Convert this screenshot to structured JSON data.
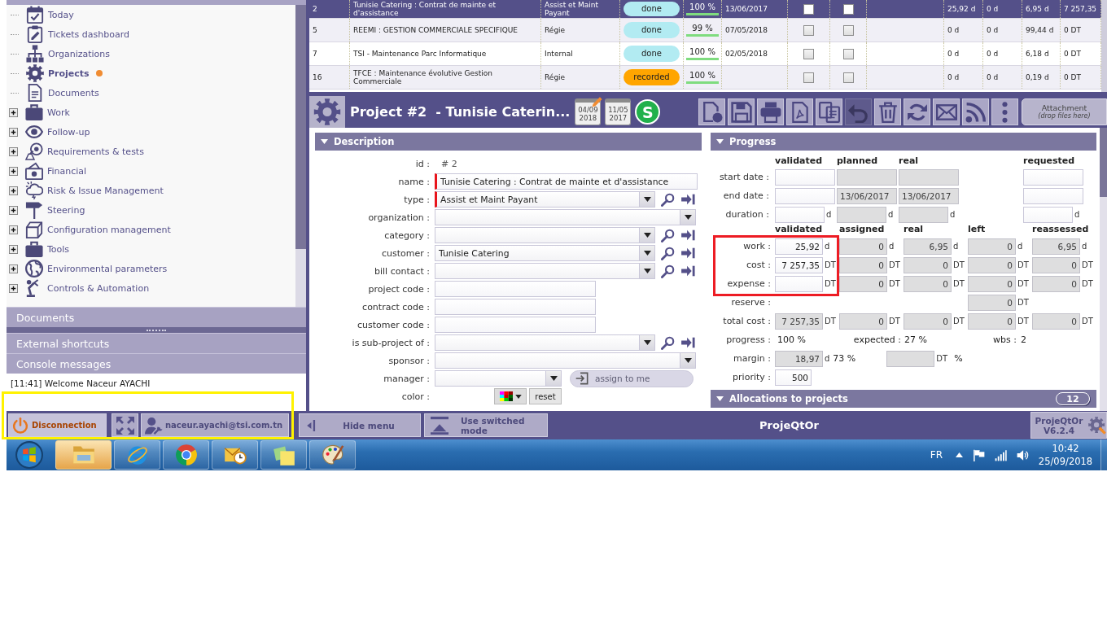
{
  "sidebar": {
    "menu": [
      {
        "label": "Today",
        "kind": "leaf",
        "selected": false
      },
      {
        "label": "Tickets dashboard",
        "kind": "leaf",
        "selected": false
      },
      {
        "label": "Organizations",
        "kind": "leaf",
        "selected": false
      },
      {
        "label": "Projects",
        "kind": "leaf",
        "selected": true
      },
      {
        "label": "Documents",
        "kind": "leaf",
        "selected": false
      },
      {
        "label": "Work",
        "kind": "group",
        "expanded": false,
        "selected": false
      },
      {
        "label": "Follow-up",
        "kind": "group",
        "expanded": false,
        "selected": false
      },
      {
        "label": "Requirements & tests",
        "kind": "group",
        "expanded": false,
        "selected": false
      },
      {
        "label": "Financial",
        "kind": "group",
        "expanded": false,
        "selected": false
      },
      {
        "label": "Risk & Issue Management",
        "kind": "group",
        "expanded": false,
        "selected": false
      },
      {
        "label": "Steering",
        "kind": "group",
        "expanded": false,
        "selected": false
      },
      {
        "label": "Configuration management",
        "kind": "group",
        "expanded": false,
        "selected": false
      },
      {
        "label": "Tools",
        "kind": "group",
        "expanded": false,
        "selected": false
      },
      {
        "label": "Environmental parameters",
        "kind": "group",
        "expanded": false,
        "selected": false
      },
      {
        "label": "Controls & Automation",
        "kind": "group",
        "expanded": false,
        "selected": false
      }
    ],
    "panels": [
      {
        "title": "Documents"
      },
      {
        "title": "External shortcuts"
      },
      {
        "title": "Console messages"
      }
    ],
    "console_messages": [
      "[11:41] Welcome Naceur AYACHI"
    ]
  },
  "project_list": {
    "rows": [
      {
        "selected": true,
        "column_1": "2",
        "column_2": "Tunisie Catering : Contrat de mainte et d'assistance",
        "column_3": "Assist et Maint Payant",
        "column_4": {
          "label": "done",
          "color": "#b2ebf2"
        },
        "column_5": {
          "label": "100 %",
          "level": 1
        },
        "column_6": "13/06/2017",
        "column_7": {
          "checked": false
        },
        "column_8": {
          "checked": false
        },
        "column_10": "25,92 d",
        "column_11": "0 d",
        "column_12": "6,95 d",
        "column_13": "7 257,35"
      },
      {
        "selected": false,
        "column_1": "5",
        "column_2": "REEMI : GESTION COMMERCIALE SPECIFIQUE",
        "column_3": "Régie",
        "column_4": {
          "label": "done",
          "color": "#b2ebf2"
        },
        "column_5": {
          "label": "99 %",
          "level": 0.99
        },
        "column_6": "07/05/2018",
        "column_7": {
          "checked": false
        },
        "column_8": {
          "checked": false
        },
        "column_10": "0 d",
        "column_11": "0 d",
        "column_12": "99,44 d",
        "column_13": "0 DT"
      },
      {
        "selected": false,
        "column_1": "7",
        "column_2": "TSI - Maintenance Parc Informatique",
        "column_3": "Internal",
        "column_4": {
          "label": "done",
          "color": "#b2ebf2"
        },
        "column_5": {
          "label": "100 %",
          "level": 1
        },
        "column_6": "02/05/2018",
        "column_7": {
          "checked": false
        },
        "column_8": {
          "checked": false
        },
        "column_10": "0 d",
        "column_11": "0 d",
        "column_12": "6,18 d",
        "column_13": "0 DT"
      },
      {
        "selected": false,
        "column_1": "16",
        "column_2": "TFCE : Maintenance évolutive Gestion Commerciale",
        "column_3": "Régie",
        "column_4": {
          "label": "recorded",
          "color": "#ffa500"
        },
        "column_5": {
          "label": "100 %",
          "level": 1
        },
        "column_7": {
          "checked": false
        },
        "column_8": {
          "checked": false
        },
        "column_10": "0 d",
        "column_11": "0 d",
        "column_12": "0,19 d",
        "column_13": "0 DT"
      }
    ]
  },
  "detail": {
    "title": "Project #2  - Tunisie Caterin...",
    "date_badges": [
      {
        "text": "04/09 2018",
        "edited": true
      },
      {
        "text": "11/05 2017",
        "edited": false
      }
    ],
    "status_badge": {
      "label": "S",
      "color": "#22b14c"
    },
    "toolbar": [
      {
        "disabled": false
      },
      {
        "disabled": false
      },
      {
        "disabled": false
      },
      {
        "disabled": false
      },
      {
        "disabled": false
      },
      {
        "disabled": true
      },
      {
        "disabled": false
      },
      {
        "disabled": false
      },
      {
        "disabled": false
      },
      {
        "disabled": false
      },
      {
        "disabled": false
      }
    ],
    "attachment": {
      "label": "Attachment",
      "hint": "(drop files here)"
    },
    "description": {
      "title": "Description",
      "expanded": true,
      "fields": [
        {
          "label": "id :",
          "kind": "id",
          "value": "# 2"
        },
        {
          "label": "name :",
          "kind": "text",
          "value": "Tunisie Catering : Contrat de mainte et d'assistance",
          "required": true
        },
        {
          "label": "type :",
          "kind": "select",
          "value": "Assist et Maint Payant",
          "required": true,
          "lookup": true
        },
        {
          "label": "organization :",
          "kind": "select",
          "required": false,
          "lookup": false
        },
        {
          "label": "category :",
          "kind": "select",
          "required": false,
          "lookup": true
        },
        {
          "label": "customer :",
          "kind": "select",
          "value": "Tunisie Catering",
          "required": false,
          "lookup": true
        },
        {
          "label": "bill contact :",
          "kind": "select",
          "required": false,
          "lookup": true
        },
        {
          "label": "project code :",
          "kind": "short_text",
          "required": false
        },
        {
          "label": "contract code :",
          "kind": "short_text",
          "required": false
        },
        {
          "label": "customer code :",
          "kind": "short_text",
          "required": false
        },
        {
          "label": "is sub-project of :",
          "kind": "select",
          "required": false,
          "lookup": true
        },
        {
          "label": "sponsor :",
          "kind": "select",
          "required": false,
          "lookup": false
        },
        {
          "label": "manager :",
          "kind": "user_select",
          "required": false,
          "button": "assign to me"
        },
        {
          "label": "color :",
          "kind": "color",
          "button": "reset"
        }
      ]
    },
    "progress": {
      "title": "Progress",
      "expanded": true,
      "date_columns": [
        "validated",
        "planned",
        "real",
        "requested"
      ],
      "date_rows": [
        {
          "label": "start date :",
          "cells": [
            {
              "readonly": false
            },
            {
              "readonly": true
            },
            {
              "readonly": true
            },
            {
              "readonly": false
            }
          ]
        },
        {
          "label": "end date :",
          "cells": [
            {
              "readonly": false
            },
            {
              "value": "13/06/2017",
              "readonly": true
            },
            {
              "value": "13/06/2017",
              "readonly": true
            },
            {
              "readonly": false
            }
          ]
        },
        {
          "label": "duration :",
          "cells": [
            {
              "unit": "d",
              "readonly": false
            },
            {
              "unit": "d",
              "readonly": true
            },
            {
              "unit": "d",
              "readonly": true
            },
            {
              "unit": "d",
              "readonly": false
            }
          ]
        }
      ],
      "cost_columns": [
        "validated",
        "assigned",
        "real",
        "left",
        "reassessed"
      ],
      "cost_rows": [
        {
          "label": "work :",
          "cells": [
            {
              "value": "25,92",
              "unit": "d",
              "readonly": false
            },
            {
              "value": "0",
              "unit": "d",
              "readonly": true
            },
            {
              "value": "6,95",
              "unit": "d",
              "readonly": true
            },
            {
              "value": "0",
              "unit": "d",
              "readonly": true
            },
            {
              "value": "6,95",
              "unit": "d",
              "readonly": true
            }
          ]
        },
        {
          "label": "cost :",
          "cells": [
            {
              "value": "7 257,35",
              "unit": "DT",
              "readonly": false
            },
            {
              "value": "0",
              "unit": "DT",
              "readonly": true
            },
            {
              "value": "0",
              "unit": "DT",
              "readonly": true
            },
            {
              "value": "0",
              "unit": "DT",
              "readonly": true
            },
            {
              "value": "0",
              "unit": "DT",
              "readonly": true
            }
          ]
        },
        {
          "label": "expense :",
          "cells": [
            {
              "unit": "DT",
              "readonly": false
            },
            {
              "value": "0",
              "unit": "DT",
              "readonly": true
            },
            {
              "value": "0",
              "unit": "DT",
              "readonly": true
            },
            {
              "value": "0",
              "unit": "DT",
              "readonly": true
            },
            {
              "value": "0",
              "unit": "DT",
              "readonly": true
            }
          ]
        },
        {
          "label": "reserve :",
          "cells": [
            null,
            null,
            null,
            {
              "value": "0",
              "unit": "DT",
              "readonly": true
            },
            null
          ]
        },
        {
          "label": "total cost :",
          "cells": [
            {
              "value": "7 257,35",
              "unit": "DT",
              "readonly": true
            },
            {
              "value": "0",
              "unit": "DT",
              "readonly": true
            },
            {
              "value": "0",
              "unit": "DT",
              "readonly": true
            },
            {
              "value": "0",
              "unit": "DT",
              "readonly": true
            },
            {
              "value": "0",
              "unit": "DT",
              "readonly": true
            }
          ]
        }
      ],
      "summary": [
        {
          "label": "progress :",
          "value": "100 %"
        },
        {
          "label": "expected :",
          "value": "27 %"
        },
        {
          "label": "wbs :",
          "value": "2"
        }
      ],
      "margin": {
        "label": "margin :",
        "items": [
          {
            "kind": "field",
            "value": "18,97",
            "unit": "d",
            "readonly": true
          },
          {
            "kind": "text",
            "text": "73 %"
          },
          {
            "kind": "field",
            "unit": "DT",
            "readonly": true
          },
          {
            "kind": "text",
            "text": "%"
          }
        ]
      },
      "priority": {
        "label": "priority :",
        "value": "500",
        "readonly": false
      }
    },
    "allocations": {
      "title": "Allocations to projects",
      "expanded": true,
      "count": "12"
    }
  },
  "bottom_bar": {
    "disconnect": "Disconnection",
    "user": "naceur.ayachi@tsi.com.tn",
    "hide_menu": "Hide menu",
    "switch_mode": "Use switched mode",
    "title": "ProjeQtOr",
    "version": {
      "name": "ProjeQtOr",
      "number": "V6.2.4"
    }
  },
  "taskbar": {
    "apps": [
      {
        "selected": true
      },
      {
        "selected": false
      },
      {
        "selected": false
      },
      {
        "selected": false
      },
      {
        "selected": false
      },
      {
        "selected": false
      }
    ],
    "language": "FR",
    "time": "10:42",
    "date": "25/09/2018"
  },
  "highlight_frames": [
    {
      "color": "#fff200"
    },
    {
      "color": "#ed1c24"
    }
  ]
}
